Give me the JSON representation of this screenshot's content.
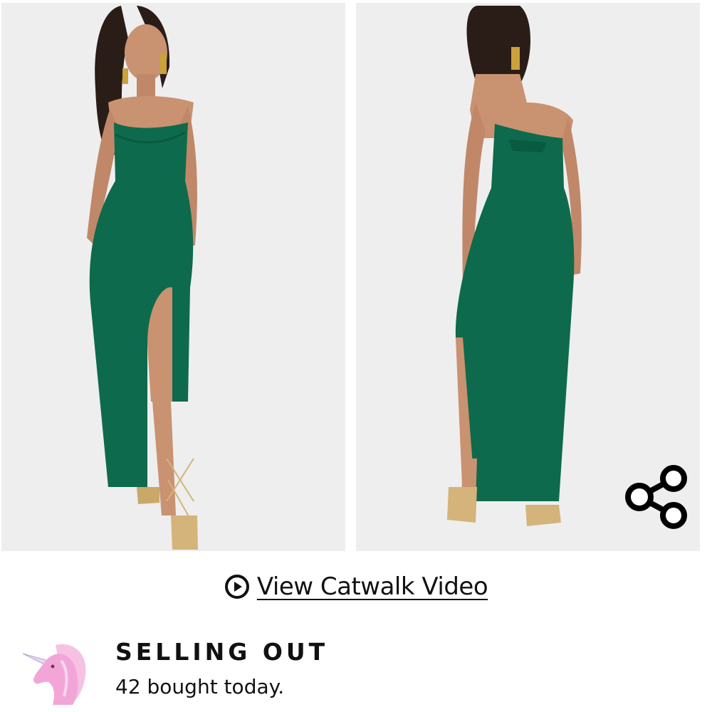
{
  "product_gallery": {
    "images": [
      {
        "view": "front",
        "alt": "Model wearing green strapless maxi dress with thigh split, front view"
      },
      {
        "view": "back",
        "alt": "Model wearing green strapless maxi dress, back view"
      }
    ],
    "dress_color": "#0e6a4c",
    "background_color": "#eeeeee",
    "share_icon": "share-icon"
  },
  "video": {
    "icon": "play-circle-icon",
    "label": "View Catwalk Video"
  },
  "stock_status": {
    "icon": "unicorn-icon",
    "title": "SELLING OUT",
    "subtitle": "42 bought today.",
    "icon_color": "#f2a6d8"
  }
}
